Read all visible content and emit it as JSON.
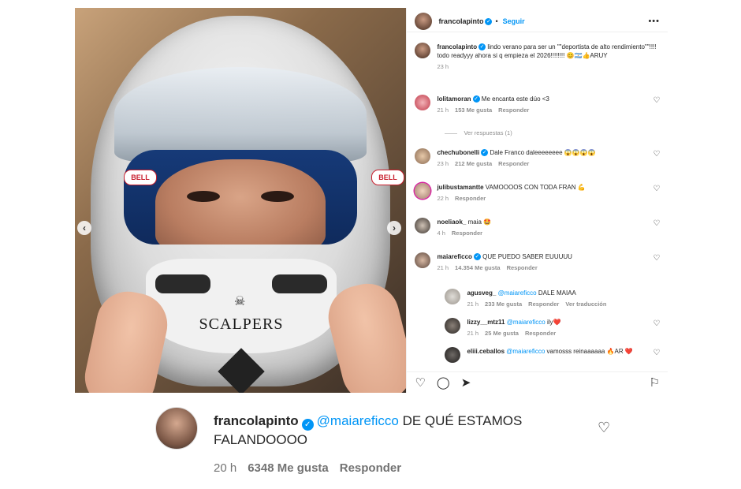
{
  "header": {
    "username": "francolapinto",
    "follow_label": "Seguir",
    "more_icon": "more-horizontal-icon"
  },
  "media": {
    "helmet_badge_left": "BELL",
    "helmet_badge_right": "BELL",
    "sponsor": "SCALPERS",
    "skull": "☠",
    "prev_icon": "chevron-left-icon",
    "next_icon": "chevron-right-icon"
  },
  "caption": {
    "username": "francolapinto",
    "text": "lindo verano para ser un \"\"deportista de alto rendimiento\"\"!!!! todo readyyy ahora si q empieza el 2026!!!!!!!! 😊🇦🇷👍ARUY",
    "time": "23 h"
  },
  "comments": [
    {
      "username": "lolitamoran",
      "verified": true,
      "text": "Me encanta este dúo <3",
      "time": "21 h",
      "likes": "153 Me gusta",
      "reply": "Responder"
    },
    {
      "username": "chechubonelli",
      "verified": true,
      "text": "Dale Franco daleeeeeeee 😱😱😱😱",
      "time": "23 h",
      "likes": "212 Me gusta",
      "reply": "Responder"
    },
    {
      "username": "julibustamantte",
      "verified": false,
      "text": "VAMOOOOS CON TODA FRAN 💪",
      "time": "22 h",
      "likes": "",
      "reply": "Responder"
    },
    {
      "username": "noeliaok_",
      "verified": false,
      "text": "maia 🤩",
      "time": "4 h",
      "likes": "",
      "reply": "Responder"
    },
    {
      "username": "maiareficco",
      "verified": true,
      "text": "QUE PUEDO SABER EUUUUU",
      "time": "21 h",
      "likes": "14.354 Me gusta",
      "reply": "Responder"
    }
  ],
  "view_replies": "Ver respuestas (1)",
  "replies": [
    {
      "username": "agusveg_",
      "mention": "@maiareficco",
      "text": "DALE MAIAA",
      "time": "21 h",
      "likes": "233 Me gusta",
      "reply": "Responder",
      "translate": "Ver traducción"
    },
    {
      "username": "lizzy__mtz11",
      "mention": "@maiareficco",
      "text": "ily❤️",
      "time": "21 h",
      "likes": "25 Me gusta",
      "reply": "Responder"
    },
    {
      "username": "eliii.ceballos",
      "mention": "@maiareficco",
      "text": "vamosss reinaaaaaa 🔥AR ❤️"
    }
  ],
  "actions": {
    "like_icon": "heart-icon",
    "comment_icon": "comment-icon",
    "share_icon": "send-icon",
    "save_icon": "bookmark-icon"
  },
  "zoom": {
    "username": "francolapinto",
    "mention": "@maiareficco",
    "text": "DE QUÉ ESTAMOS FALANDOOOO",
    "time": "20 h",
    "likes": "6348 Me gusta",
    "reply": "Responder"
  },
  "colors": {
    "link": "#0095f6",
    "text": "#262626",
    "meta": "#8e8e8e"
  }
}
